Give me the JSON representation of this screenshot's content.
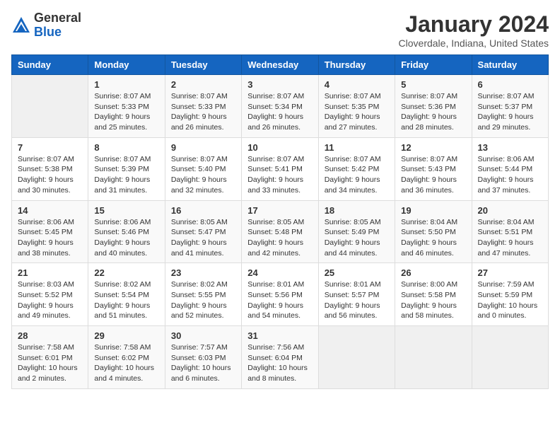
{
  "header": {
    "logo_general": "General",
    "logo_blue": "Blue",
    "month": "January 2024",
    "location": "Cloverdale, Indiana, United States"
  },
  "weekdays": [
    "Sunday",
    "Monday",
    "Tuesday",
    "Wednesday",
    "Thursday",
    "Friday",
    "Saturday"
  ],
  "weeks": [
    [
      {
        "day": "",
        "sunrise": "",
        "sunset": "",
        "daylight": ""
      },
      {
        "day": "1",
        "sunrise": "Sunrise: 8:07 AM",
        "sunset": "Sunset: 5:33 PM",
        "daylight": "Daylight: 9 hours and 25 minutes."
      },
      {
        "day": "2",
        "sunrise": "Sunrise: 8:07 AM",
        "sunset": "Sunset: 5:33 PM",
        "daylight": "Daylight: 9 hours and 26 minutes."
      },
      {
        "day": "3",
        "sunrise": "Sunrise: 8:07 AM",
        "sunset": "Sunset: 5:34 PM",
        "daylight": "Daylight: 9 hours and 26 minutes."
      },
      {
        "day": "4",
        "sunrise": "Sunrise: 8:07 AM",
        "sunset": "Sunset: 5:35 PM",
        "daylight": "Daylight: 9 hours and 27 minutes."
      },
      {
        "day": "5",
        "sunrise": "Sunrise: 8:07 AM",
        "sunset": "Sunset: 5:36 PM",
        "daylight": "Daylight: 9 hours and 28 minutes."
      },
      {
        "day": "6",
        "sunrise": "Sunrise: 8:07 AM",
        "sunset": "Sunset: 5:37 PM",
        "daylight": "Daylight: 9 hours and 29 minutes."
      }
    ],
    [
      {
        "day": "7",
        "sunrise": "Sunrise: 8:07 AM",
        "sunset": "Sunset: 5:38 PM",
        "daylight": "Daylight: 9 hours and 30 minutes."
      },
      {
        "day": "8",
        "sunrise": "Sunrise: 8:07 AM",
        "sunset": "Sunset: 5:39 PM",
        "daylight": "Daylight: 9 hours and 31 minutes."
      },
      {
        "day": "9",
        "sunrise": "Sunrise: 8:07 AM",
        "sunset": "Sunset: 5:40 PM",
        "daylight": "Daylight: 9 hours and 32 minutes."
      },
      {
        "day": "10",
        "sunrise": "Sunrise: 8:07 AM",
        "sunset": "Sunset: 5:41 PM",
        "daylight": "Daylight: 9 hours and 33 minutes."
      },
      {
        "day": "11",
        "sunrise": "Sunrise: 8:07 AM",
        "sunset": "Sunset: 5:42 PM",
        "daylight": "Daylight: 9 hours and 34 minutes."
      },
      {
        "day": "12",
        "sunrise": "Sunrise: 8:07 AM",
        "sunset": "Sunset: 5:43 PM",
        "daylight": "Daylight: 9 hours and 36 minutes."
      },
      {
        "day": "13",
        "sunrise": "Sunrise: 8:06 AM",
        "sunset": "Sunset: 5:44 PM",
        "daylight": "Daylight: 9 hours and 37 minutes."
      }
    ],
    [
      {
        "day": "14",
        "sunrise": "Sunrise: 8:06 AM",
        "sunset": "Sunset: 5:45 PM",
        "daylight": "Daylight: 9 hours and 38 minutes."
      },
      {
        "day": "15",
        "sunrise": "Sunrise: 8:06 AM",
        "sunset": "Sunset: 5:46 PM",
        "daylight": "Daylight: 9 hours and 40 minutes."
      },
      {
        "day": "16",
        "sunrise": "Sunrise: 8:05 AM",
        "sunset": "Sunset: 5:47 PM",
        "daylight": "Daylight: 9 hours and 41 minutes."
      },
      {
        "day": "17",
        "sunrise": "Sunrise: 8:05 AM",
        "sunset": "Sunset: 5:48 PM",
        "daylight": "Daylight: 9 hours and 42 minutes."
      },
      {
        "day": "18",
        "sunrise": "Sunrise: 8:05 AM",
        "sunset": "Sunset: 5:49 PM",
        "daylight": "Daylight: 9 hours and 44 minutes."
      },
      {
        "day": "19",
        "sunrise": "Sunrise: 8:04 AM",
        "sunset": "Sunset: 5:50 PM",
        "daylight": "Daylight: 9 hours and 46 minutes."
      },
      {
        "day": "20",
        "sunrise": "Sunrise: 8:04 AM",
        "sunset": "Sunset: 5:51 PM",
        "daylight": "Daylight: 9 hours and 47 minutes."
      }
    ],
    [
      {
        "day": "21",
        "sunrise": "Sunrise: 8:03 AM",
        "sunset": "Sunset: 5:52 PM",
        "daylight": "Daylight: 9 hours and 49 minutes."
      },
      {
        "day": "22",
        "sunrise": "Sunrise: 8:02 AM",
        "sunset": "Sunset: 5:54 PM",
        "daylight": "Daylight: 9 hours and 51 minutes."
      },
      {
        "day": "23",
        "sunrise": "Sunrise: 8:02 AM",
        "sunset": "Sunset: 5:55 PM",
        "daylight": "Daylight: 9 hours and 52 minutes."
      },
      {
        "day": "24",
        "sunrise": "Sunrise: 8:01 AM",
        "sunset": "Sunset: 5:56 PM",
        "daylight": "Daylight: 9 hours and 54 minutes."
      },
      {
        "day": "25",
        "sunrise": "Sunrise: 8:01 AM",
        "sunset": "Sunset: 5:57 PM",
        "daylight": "Daylight: 9 hours and 56 minutes."
      },
      {
        "day": "26",
        "sunrise": "Sunrise: 8:00 AM",
        "sunset": "Sunset: 5:58 PM",
        "daylight": "Daylight: 9 hours and 58 minutes."
      },
      {
        "day": "27",
        "sunrise": "Sunrise: 7:59 AM",
        "sunset": "Sunset: 5:59 PM",
        "daylight": "Daylight: 10 hours and 0 minutes."
      }
    ],
    [
      {
        "day": "28",
        "sunrise": "Sunrise: 7:58 AM",
        "sunset": "Sunset: 6:01 PM",
        "daylight": "Daylight: 10 hours and 2 minutes."
      },
      {
        "day": "29",
        "sunrise": "Sunrise: 7:58 AM",
        "sunset": "Sunset: 6:02 PM",
        "daylight": "Daylight: 10 hours and 4 minutes."
      },
      {
        "day": "30",
        "sunrise": "Sunrise: 7:57 AM",
        "sunset": "Sunset: 6:03 PM",
        "daylight": "Daylight: 10 hours and 6 minutes."
      },
      {
        "day": "31",
        "sunrise": "Sunrise: 7:56 AM",
        "sunset": "Sunset: 6:04 PM",
        "daylight": "Daylight: 10 hours and 8 minutes."
      },
      {
        "day": "",
        "sunrise": "",
        "sunset": "",
        "daylight": ""
      },
      {
        "day": "",
        "sunrise": "",
        "sunset": "",
        "daylight": ""
      },
      {
        "day": "",
        "sunrise": "",
        "sunset": "",
        "daylight": ""
      }
    ]
  ]
}
